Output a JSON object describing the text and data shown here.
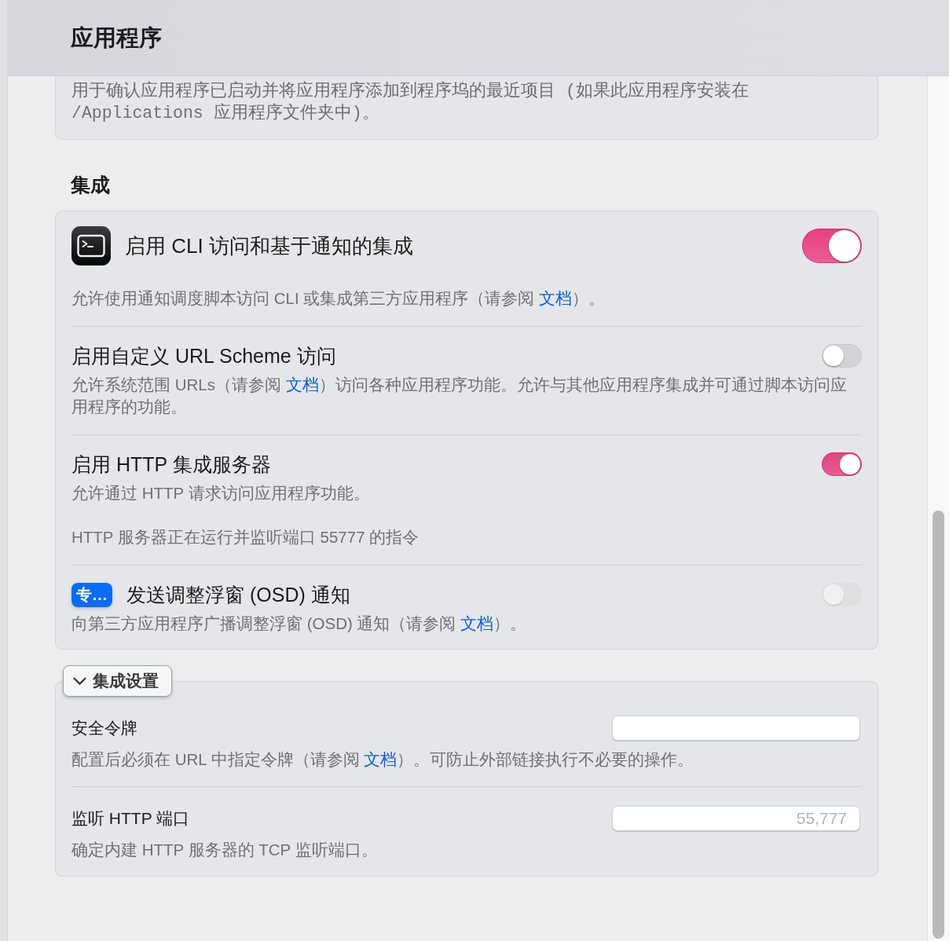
{
  "header": {
    "title": "应用程序"
  },
  "intro_card": {
    "description": "用于确认应用程序已启动并将应用程序添加到程序坞的最近项目 (如果此应用程序安装在 /Applications 应用程序文件夹中)。"
  },
  "integration": {
    "heading": "集成",
    "rows": [
      {
        "kind": "app",
        "title": "启用 CLI 访问和基于通知的集成",
        "on": true,
        "disabled": false,
        "description": [
          {
            "kind": "text",
            "text": "允许使用通知调度脚本访问 CLI 或集成第三方应用程序（请参阅 "
          },
          {
            "kind": "link",
            "text": "文档"
          },
          {
            "kind": "text",
            "text": "）。"
          }
        ]
      },
      {
        "kind": "plain",
        "title": "启用自定义 URL Scheme 访问",
        "on": false,
        "disabled": false,
        "description": [
          {
            "kind": "text",
            "text": "允许系统范围 URLs（请参阅 "
          },
          {
            "kind": "link",
            "text": "文档"
          },
          {
            "kind": "text",
            "text": "）访问各种应用程序功能。允许与其他应用程序集成并可通过脚本访问应用程序的功能。"
          }
        ]
      },
      {
        "kind": "plain",
        "title": "启用 HTTP 集成服务器",
        "on": true,
        "disabled": false,
        "description": [
          {
            "kind": "text",
            "text": "允许通过 HTTP 请求访问应用程序功能。"
          }
        ],
        "status": "HTTP 服务器正在运行并监听端口 55777 的指令"
      },
      {
        "kind": "pro",
        "badge": "专…",
        "title": "发送调整浮窗 (OSD) 通知",
        "on": false,
        "disabled": true,
        "description": [
          {
            "kind": "text",
            "text": "向第三方应用程序广播调整浮窗 (OSD) 通知（请参阅 "
          },
          {
            "kind": "link",
            "text": "文档"
          },
          {
            "kind": "text",
            "text": "）。"
          }
        ]
      }
    ]
  },
  "settings": {
    "disclosure": {
      "label": "集成设置",
      "expanded": true
    },
    "fields": [
      {
        "label": "安全令牌",
        "description": [
          {
            "kind": "text",
            "text": "配置后必须在 URL 中指定令牌（请参阅 "
          },
          {
            "kind": "link",
            "text": "文档"
          },
          {
            "kind": "text",
            "text": "）。可防止外部链接执行不必要的操作。"
          }
        ]
      },
      {
        "label": "监听 HTTP 端口",
        "placeholder": "55,777",
        "description": [
          {
            "kind": "text",
            "text": "确定内建 HTTP 服务器的 TCP 监听端口。"
          }
        ]
      }
    ]
  }
}
